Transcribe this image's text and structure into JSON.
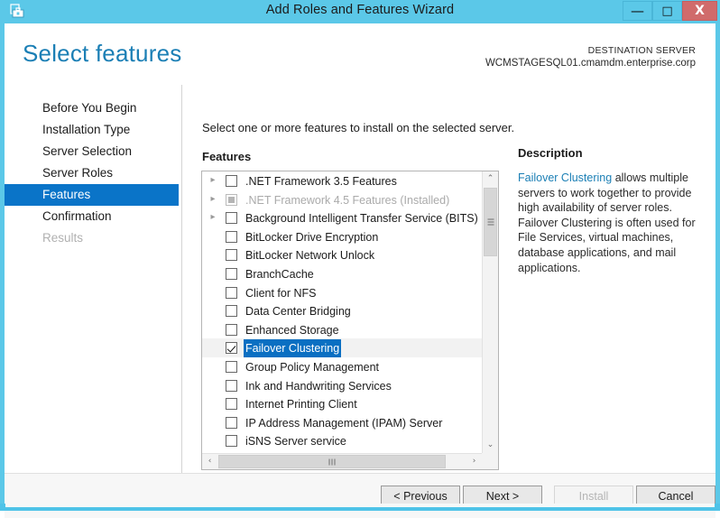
{
  "window": {
    "title": "Add Roles and Features Wizard",
    "icon": "wizard-toolbox-icon",
    "accent_color": "#5bc8e8",
    "controls": {
      "minimize": "–",
      "maximize": "☐",
      "close": "X"
    }
  },
  "header": {
    "page_title": "Select features",
    "destination_label": "DESTINATION SERVER",
    "destination_server": "WCMSTAGESQL01.cmamdm.enterprise.corp",
    "title_color": "#1b7fb5"
  },
  "sidebar": {
    "selected_color": "#0a74c8",
    "items": [
      {
        "label": "Before You Begin",
        "state": "normal"
      },
      {
        "label": "Installation Type",
        "state": "normal"
      },
      {
        "label": "Server Selection",
        "state": "normal"
      },
      {
        "label": "Server Roles",
        "state": "normal"
      },
      {
        "label": "Features",
        "state": "selected"
      },
      {
        "label": "Confirmation",
        "state": "normal"
      },
      {
        "label": "Results",
        "state": "disabled"
      }
    ]
  },
  "main": {
    "instruction": "Select one or more features to install on the selected server.",
    "features_label": "Features",
    "features": [
      {
        "label": ".NET Framework 3.5 Features",
        "checkbox": "unchecked",
        "expander": true,
        "dim": false,
        "selected": false
      },
      {
        "label": ".NET Framework 4.5 Features (Installed)",
        "checkbox": "installed",
        "expander": true,
        "dim": true,
        "selected": false
      },
      {
        "label": "Background Intelligent Transfer Service (BITS)",
        "checkbox": "unchecked",
        "expander": true,
        "dim": false,
        "selected": false
      },
      {
        "label": "BitLocker Drive Encryption",
        "checkbox": "unchecked",
        "expander": false,
        "dim": false,
        "selected": false
      },
      {
        "label": "BitLocker Network Unlock",
        "checkbox": "unchecked",
        "expander": false,
        "dim": false,
        "selected": false
      },
      {
        "label": "BranchCache",
        "checkbox": "unchecked",
        "expander": false,
        "dim": false,
        "selected": false
      },
      {
        "label": "Client for NFS",
        "checkbox": "unchecked",
        "expander": false,
        "dim": false,
        "selected": false
      },
      {
        "label": "Data Center Bridging",
        "checkbox": "unchecked",
        "expander": false,
        "dim": false,
        "selected": false
      },
      {
        "label": "Enhanced Storage",
        "checkbox": "unchecked",
        "expander": false,
        "dim": false,
        "selected": false
      },
      {
        "label": "Failover Clustering",
        "checkbox": "checked",
        "expander": false,
        "dim": false,
        "selected": true
      },
      {
        "label": "Group Policy Management",
        "checkbox": "unchecked",
        "expander": false,
        "dim": false,
        "selected": false
      },
      {
        "label": "Ink and Handwriting Services",
        "checkbox": "unchecked",
        "expander": false,
        "dim": false,
        "selected": false
      },
      {
        "label": "Internet Printing Client",
        "checkbox": "unchecked",
        "expander": false,
        "dim": false,
        "selected": false
      },
      {
        "label": "IP Address Management (IPAM) Server",
        "checkbox": "unchecked",
        "expander": false,
        "dim": false,
        "selected": false
      },
      {
        "label": "iSNS Server service",
        "checkbox": "unchecked",
        "expander": false,
        "dim": false,
        "selected": false
      }
    ],
    "selection_highlight_color": "#0a6fc2",
    "scrollbar": {
      "up_arrow": "⌃",
      "down_arrow": "⌄",
      "left_arrow": "‹",
      "right_arrow": "›"
    }
  },
  "description": {
    "title": "Description",
    "link_text": "Failover Clustering",
    "body": " allows multiple servers to work together to provide high availability of server roles. Failover Clustering is often used for File Services, virtual machines, database applications, and mail applications.",
    "link_color": "#1b7fb5"
  },
  "footer": {
    "previous": "< Previous",
    "next": "Next >",
    "install": "Install",
    "cancel": "Cancel",
    "install_enabled": false
  }
}
